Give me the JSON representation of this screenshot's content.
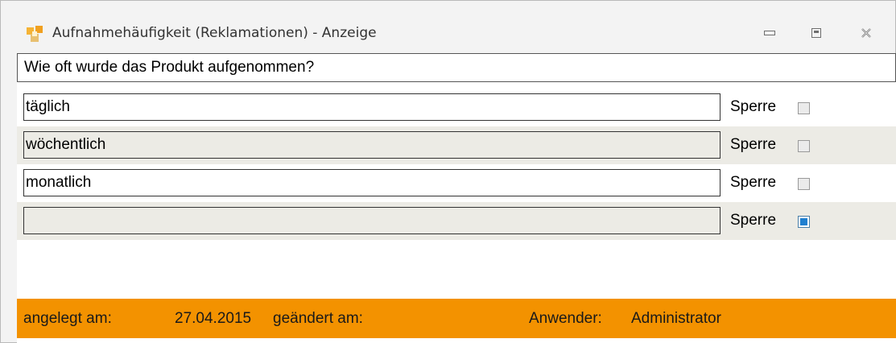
{
  "window": {
    "title": "Aufnahmehäufigkeit (Reklamationen) - Anzeige",
    "icon": "app-icon"
  },
  "question": "Wie oft wurde das Produkt aufgenommen?",
  "rows": [
    {
      "value": "täglich",
      "lock_label": "Sperre",
      "locked": false
    },
    {
      "value": "wöchentlich",
      "lock_label": "Sperre",
      "locked": false
    },
    {
      "value": "monatlich",
      "lock_label": "Sperre",
      "locked": false
    },
    {
      "value": "",
      "lock_label": "Sperre",
      "locked": true
    }
  ],
  "footer": {
    "created_label": "angelegt am:",
    "created_date": "27.04.2015",
    "changed_label": "geändert am:",
    "user_label": "Anwender:",
    "user_value": "Administrator"
  },
  "colors": {
    "footer": "#f39200",
    "alt_row": "#ecebe5",
    "checked": "#1f7fd0"
  }
}
